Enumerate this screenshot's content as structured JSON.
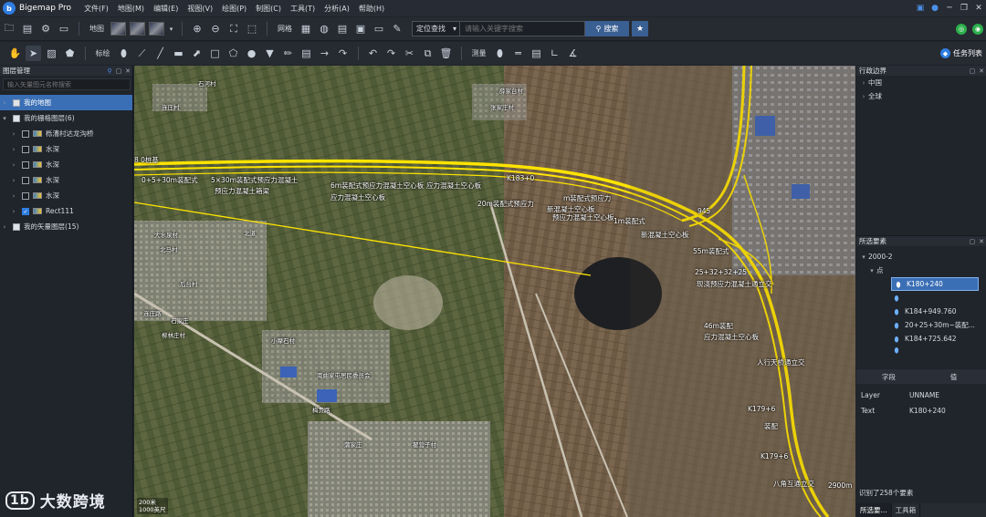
{
  "app": {
    "title": "Bigemap Pro",
    "logo_text": "b"
  },
  "menus": [
    "文件(F)",
    "地图(M)",
    "编辑(E)",
    "视图(V)",
    "绘图(P)",
    "制图(C)",
    "工具(T)",
    "分析(A)",
    "帮助(H)"
  ],
  "toolbar1": {
    "map_label": "地图",
    "grid_label": "网格",
    "locate_select": "定位查找",
    "search_placeholder": "请输入关键字搜索",
    "search_button": "搜索",
    "task_list": "任务列表"
  },
  "toolbar2": {
    "annotate_label": "标绘",
    "measure_label": "测量"
  },
  "left_panel": {
    "title": "图层管理",
    "search_placeholder": "输入矢量图元名称搜索",
    "items": [
      {
        "label": "我的地图",
        "level": 0,
        "selected": true
      },
      {
        "label": "我的栅格图层(6)",
        "level": 0,
        "expand": "▾"
      },
      {
        "label": "栎漕村达龙沟桥",
        "level": 1
      },
      {
        "label": "水深",
        "level": 1
      },
      {
        "label": "水深",
        "level": 1
      },
      {
        "label": "水深",
        "level": 1
      },
      {
        "label": "水深",
        "level": 1
      },
      {
        "label": "Rect111",
        "level": 1,
        "checked": true
      },
      {
        "label": "我的矢量图层(15)",
        "level": 0
      }
    ]
  },
  "watermark": {
    "logo": "1b",
    "text": "大数跨境"
  },
  "map": {
    "labels": [
      {
        "text": "8 0桩基"
      },
      {
        "text": "0+5+30m装配式"
      },
      {
        "text": "预应力混凝土箱梁"
      },
      {
        "text": "5×30m装配式预应力混凝土"
      },
      {
        "text": "应力混凝土空心板"
      },
      {
        "text": "6m装配式预应力混凝土空心板"
      },
      {
        "text": "应力混凝土空心板"
      },
      {
        "text": "K183+0"
      },
      {
        "text": "m装配式预应力"
      },
      {
        "text": "20m装配式预应力"
      },
      {
        "text": "预应力混凝土空心板"
      },
      {
        "text": "新混凝土空心板"
      },
      {
        "text": "945"
      },
      {
        "text": "1m装配式"
      },
      {
        "text": "新混凝土空心板"
      },
      {
        "text": "55m装配式"
      },
      {
        "text": "25+32+32+25"
      },
      {
        "text": "现浇预应力混凝土通立交"
      },
      {
        "text": "46m装配"
      },
      {
        "text": "应力混凝土空心板"
      },
      {
        "text": "人行天桥通立交"
      },
      {
        "text": "K179+6"
      },
      {
        "text": "装配"
      },
      {
        "text": "K179+6"
      },
      {
        "text": "八角互通立交"
      },
      {
        "text": "2900m"
      }
    ],
    "places": [
      "石河村",
      "连庄村",
      "薛家台村",
      "张家庄村",
      "大水泉村",
      "北马村",
      "后台村",
      "北道",
      "连庄路",
      "石家庄",
      "梅贵路",
      "柳林庄村",
      "南曲家屯居民委员会",
      "小摩石村",
      "蒲家庄",
      "翟营子村"
    ],
    "scale": {
      "line1": "200米",
      "line2": "1000英尺"
    }
  },
  "right_panel": {
    "region_title": "行政边界",
    "regions": [
      "中国",
      "全球"
    ],
    "select_title": "所选要素",
    "group": "2000-2",
    "subgroup": "点",
    "features": [
      "K180+240",
      "",
      "K184+949.760",
      "20+25+30m~装配...",
      "K184+725.642",
      ""
    ],
    "attr_headers": {
      "field": "字段",
      "value": "值"
    },
    "attrs": [
      {
        "field": "Layer",
        "value": "UNNAME"
      },
      {
        "field": "Text",
        "value": "K180+240"
      }
    ],
    "found": "识别了258个要素",
    "tabs": [
      "所选要...",
      "工具箱"
    ]
  },
  "colors": {
    "road": "#ffe400",
    "accent": "#2f7de1",
    "selected": "#3b6fb5"
  }
}
